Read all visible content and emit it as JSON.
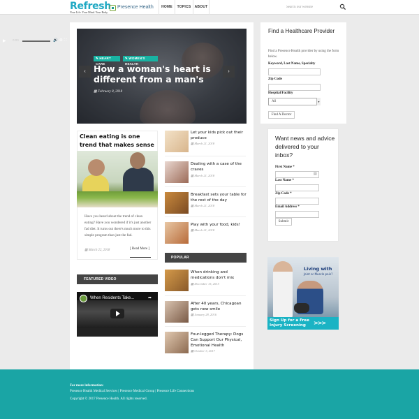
{
  "header": {
    "logo": "Refresh",
    "tagline": "Your Life. Your Mind. Your Body.",
    "brand": "Presence Health",
    "nav": [
      "HOME",
      "TOPICS",
      "ABOUT"
    ],
    "search_placeholder": "Search our website"
  },
  "slider": {
    "tags": [
      "HEART CARE",
      "WOMEN'S HEALTH"
    ],
    "title": "How a woman's heart is different from a man's",
    "date": "February 8, 2018",
    "prev": "‹",
    "next": "›"
  },
  "feature": {
    "title": "Clean eating is one trend that makes sense",
    "excerpt": "Have you heard about the trend of clean eating? Have you wondered if it's just another fad diet. It turns out there's much more to this simple program than just the fad.",
    "date": "March 22, 2018",
    "read_more": "[ Read More ]"
  },
  "video": {
    "header": "FEATURED VIDEO",
    "title": "When Residents Take...",
    "share": "➦",
    "time": "0:00"
  },
  "articles": [
    {
      "title": "Let your kids pick out their produce",
      "date": "March 21, 2018"
    },
    {
      "title": "Dealing with a case of the craves",
      "date": "March 21, 2018"
    },
    {
      "title": "Breakfast sets your table for the rest of the day",
      "date": "March 21, 2018"
    },
    {
      "title": "Play with your food, kids!",
      "date": "March 21, 2018"
    }
  ],
  "popular": {
    "header": "POPULAR",
    "items": [
      {
        "title": "When drinking and medications don't mix",
        "date": "December 15, 2015"
      },
      {
        "title": "After 40 years, Chicagoan gets new smile",
        "date": "January 28, 2016"
      },
      {
        "title": "Four-legged Therapy: Dogs Can Support Our Physical, Emotional Health",
        "date": "October 3, 2017"
      }
    ]
  },
  "provider": {
    "title": "Find a Healthcare Provider",
    "intro": "Find a Presence Health provider by using the form below.",
    "keyword_label": "Keyword, Last Name, Specialty",
    "zip_label": "Zip Code",
    "hospital_label": "Hospital/Facility",
    "hospital_value": "All",
    "button": "Find A Doctor"
  },
  "newsletter": {
    "title": "Want news and advice delivered to your inbox?",
    "first_name": "First Name *",
    "last_name": "Last Name *",
    "zip": "Zip Code *",
    "email": "Email Address *",
    "submit": "Submit"
  },
  "ad": {
    "headline": "Living with",
    "sub": "Joint or Muscle pain?",
    "cta": "Sign Up for a Free Injury Screening",
    "arrows": ">>>"
  },
  "footer": {
    "heading": "For more information:",
    "links": "Presence Health Medical Services | Presence Medical Group | Presence Life Connections",
    "copyright": "Copyright © 2017 Presence Health. All rights reserved."
  },
  "colors": {
    "accent": "#1aa5a5",
    "tag": "#18b3a3",
    "logo": "#1fa8c3"
  }
}
